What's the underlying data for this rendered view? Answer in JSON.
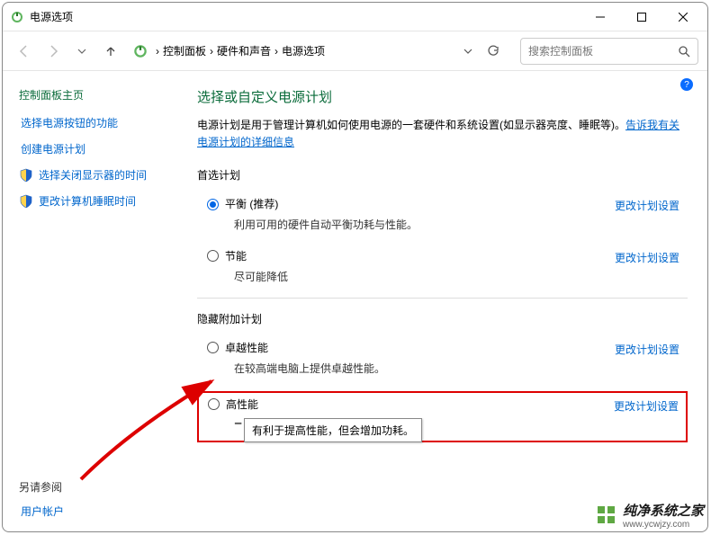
{
  "titlebar": {
    "title": "电源选项"
  },
  "toolbar": {
    "breadcrumb": {
      "b1": "控制面板",
      "b2": "硬件和声音",
      "b3": "电源选项",
      "sep": "›"
    },
    "search_placeholder": "搜索控制面板"
  },
  "sidebar": {
    "home": "控制面板主页",
    "link_buttons": "选择电源按钮的功能",
    "link_create_plan": "创建电源计划",
    "link_display_off": "选择关闭显示器的时间",
    "link_sleep": "更改计算机睡眠时间",
    "see_also": "另请参阅",
    "user_accounts": "用户帐户"
  },
  "main": {
    "heading": "选择或自定义电源计划",
    "desc1": "电源计划是用于管理计算机如何使用电源的一套硬件和系统设置(如显示器亮度、睡眠等)。",
    "desc_link": "告诉我有关电源计划的详细信息",
    "preferred_label": "首选计划",
    "hidden_label": "隐藏附加计划",
    "change_link": "更改计划设置",
    "plans": {
      "balanced": {
        "name": "平衡 (推荐)",
        "desc": "利用可用的硬件自动平衡功耗与性能。"
      },
      "saver": {
        "name": "节能",
        "desc": "尽可能降低"
      },
      "ultimate": {
        "name": "卓越性能",
        "desc": "在较高端电脑上提供卓越性能。"
      },
      "high": {
        "name": "高性能",
        "desc_cut": "有利于提高性能，但会增加功耗。"
      }
    },
    "tooltip": "有利于提高性能，但会增加功耗。"
  },
  "watermark": {
    "title": "纯净系统之家",
    "sub": "www.ycwjzy.com"
  }
}
